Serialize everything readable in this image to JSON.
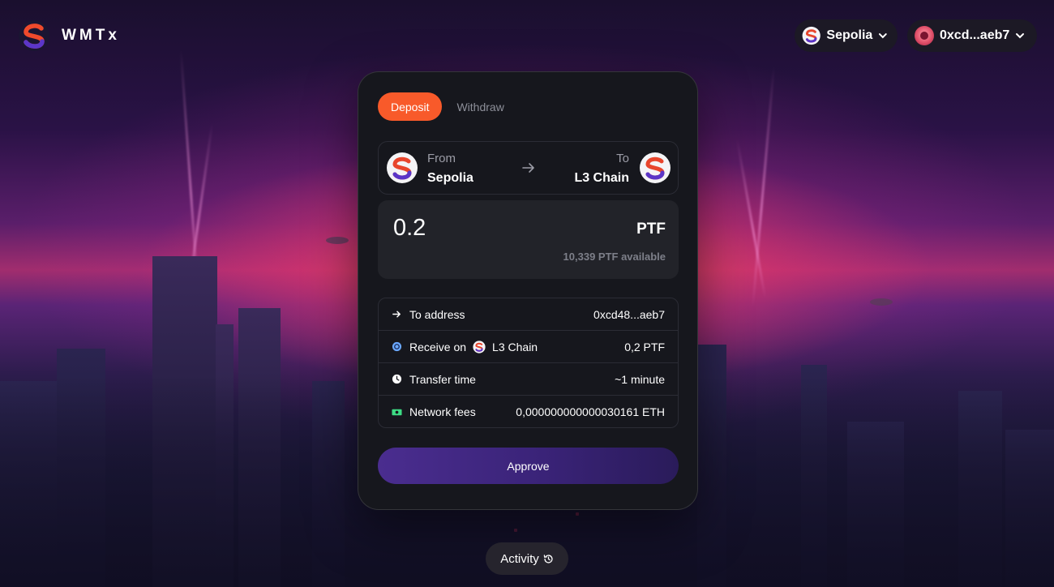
{
  "app": {
    "name": "WMTx"
  },
  "header": {
    "network": {
      "name": "Sepolia",
      "icon": "chain-logo-icon"
    },
    "account": {
      "address": "0xcd...aeb7",
      "icon": "avatar-icon"
    }
  },
  "tabs": [
    {
      "label": "Deposit",
      "active": true
    },
    {
      "label": "Withdraw",
      "active": false
    }
  ],
  "route": {
    "from_label": "From",
    "from_chain": "Sepolia",
    "to_label": "To",
    "to_chain": "L3 Chain"
  },
  "amount": {
    "value": "0.2",
    "token": "PTF",
    "available": "10,339 PTF available"
  },
  "details": {
    "to_address_label": "To address",
    "to_address_value": "0xcd48...aeb7",
    "receive_label": "Receive on",
    "receive_chain": "L3 Chain",
    "receive_value": "0,2 PTF",
    "transfer_time_label": "Transfer time",
    "transfer_time_value": "~1 minute",
    "network_fees_label": "Network fees",
    "network_fees_value": "0,000000000000030161 ETH"
  },
  "approve_label": "Approve",
  "activity_label": "Activity",
  "colors": {
    "accent": "#f85a2a",
    "approve": "#4a2d8f",
    "card": "#16171d",
    "fee_icon": "#3ddc84"
  }
}
